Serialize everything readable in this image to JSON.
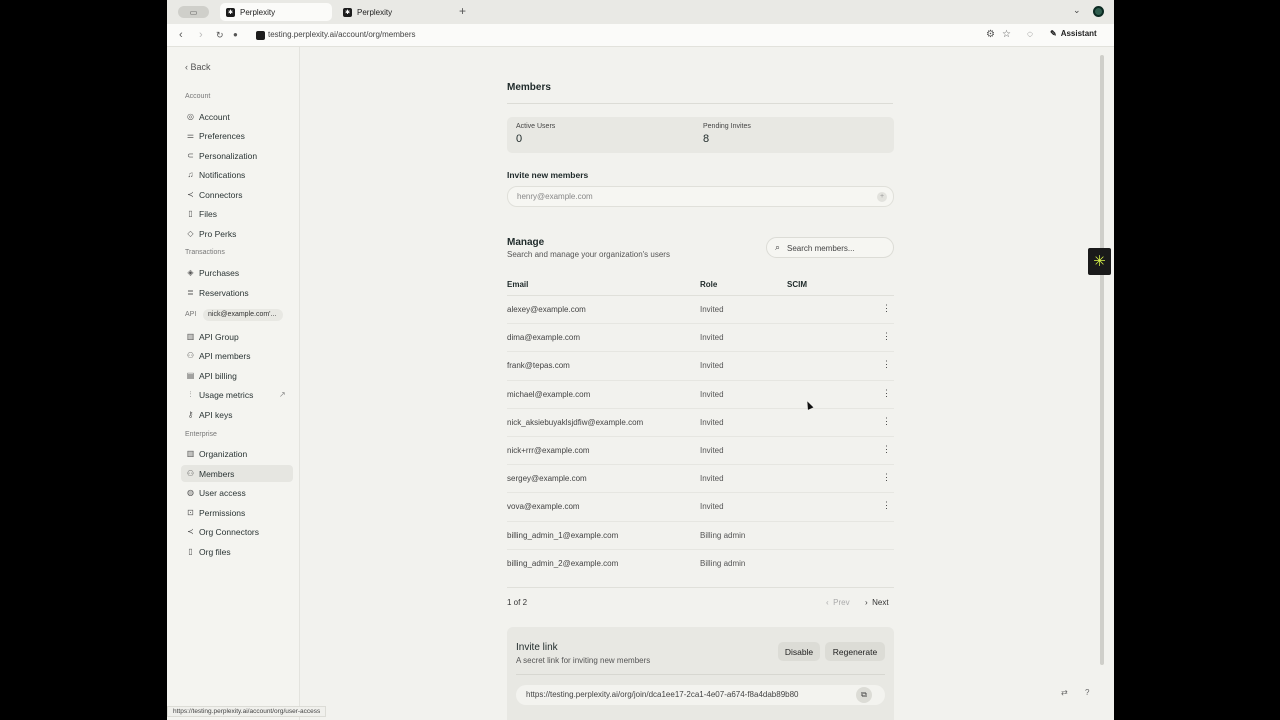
{
  "browser": {
    "tabs": [
      {
        "label": "Perplexity",
        "active": true
      },
      {
        "label": "Perplexity",
        "active": false
      }
    ],
    "url": "testing.perplexity.ai/account/org/members",
    "assistant_label": "Assistant",
    "status_url": "https://testing.perplexity.ai/account/org/user-access"
  },
  "nav": {
    "back_label": "Back",
    "sections": {
      "account": "Account",
      "transactions": "Transactions",
      "api": "API",
      "enterprise": "Enterprise"
    },
    "api_account": "nick@example.com'...",
    "items": {
      "account": "Account",
      "preferences": "Preferences",
      "personalization": "Personalization",
      "notifications": "Notifications",
      "connectors": "Connectors",
      "files": "Files",
      "pro_perks": "Pro Perks",
      "purchases": "Purchases",
      "reservations": "Reservations",
      "api_group": "API Group",
      "api_members": "API members",
      "api_billing": "API billing",
      "usage_metrics": "Usage metrics",
      "api_keys": "API keys",
      "organization": "Organization",
      "members": "Members",
      "user_access": "User access",
      "permissions": "Permissions",
      "org_connectors": "Org Connectors",
      "org_files": "Org files"
    }
  },
  "main": {
    "title": "Members",
    "stats": {
      "active_label": "Active Users",
      "active_value": "0",
      "pending_label": "Pending Invites",
      "pending_value": "8"
    },
    "invite": {
      "label": "Invite new members",
      "placeholder": "henry@example.com"
    },
    "manage": {
      "title": "Manage",
      "subtitle": "Search and manage your organization's users",
      "search_placeholder": "Search members..."
    },
    "table": {
      "columns": {
        "email": "Email",
        "role": "Role",
        "scim": "SCIM"
      },
      "rows": [
        {
          "email": "alexey@example.com",
          "role": "Invited",
          "menu": true
        },
        {
          "email": "dima@example.com",
          "role": "Invited",
          "menu": true
        },
        {
          "email": "frank@tepas.com",
          "role": "Invited",
          "menu": true
        },
        {
          "email": "michael@example.com",
          "role": "Invited",
          "menu": true
        },
        {
          "email": "nick_aksiebuyaklsjdfiw@example.com",
          "role": "Invited",
          "menu": true
        },
        {
          "email": "nick+rrr@example.com",
          "role": "Invited",
          "menu": true
        },
        {
          "email": "sergey@example.com",
          "role": "Invited",
          "menu": true
        },
        {
          "email": "vova@example.com",
          "role": "Invited",
          "menu": true
        },
        {
          "email": "billing_admin_1@example.com",
          "role": "Billing admin",
          "menu": false
        },
        {
          "email": "billing_admin_2@example.com",
          "role": "Billing admin",
          "menu": false
        }
      ]
    },
    "pagination": {
      "label": "1 of 2",
      "prev": "Prev",
      "next": "Next"
    },
    "invite_link": {
      "title": "Invite link",
      "subtitle": "A secret link for inviting new members",
      "disable_label": "Disable",
      "regenerate_label": "Regenerate",
      "url": "https://testing.perplexity.ai/org/join/dca1ee17-2ca1-4e07-a674-f8a4dab89b80"
    }
  },
  "colors": {
    "page_bg": "#f2f2ee",
    "card_bg": "#e8e8e3",
    "text": "#1f2a2a",
    "widget_accent": "#d7f24a"
  }
}
